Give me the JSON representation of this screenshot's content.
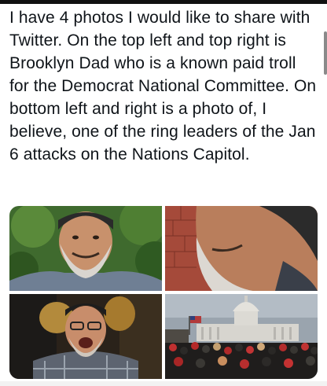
{
  "tweet": {
    "text": "I have 4 photos I would like to share with Twitter. On the top left and top right is Brooklyn Dad who is a known paid troll for the Democrat National Committee. On bottom left and right is a photo of, I believe, one of the ring leaders of the Jan 6 attacks on the Nations Capitol."
  },
  "photos": [
    {
      "name": "photo-top-left"
    },
    {
      "name": "photo-top-right"
    },
    {
      "name": "photo-bottom-left"
    },
    {
      "name": "photo-bottom-right"
    }
  ]
}
